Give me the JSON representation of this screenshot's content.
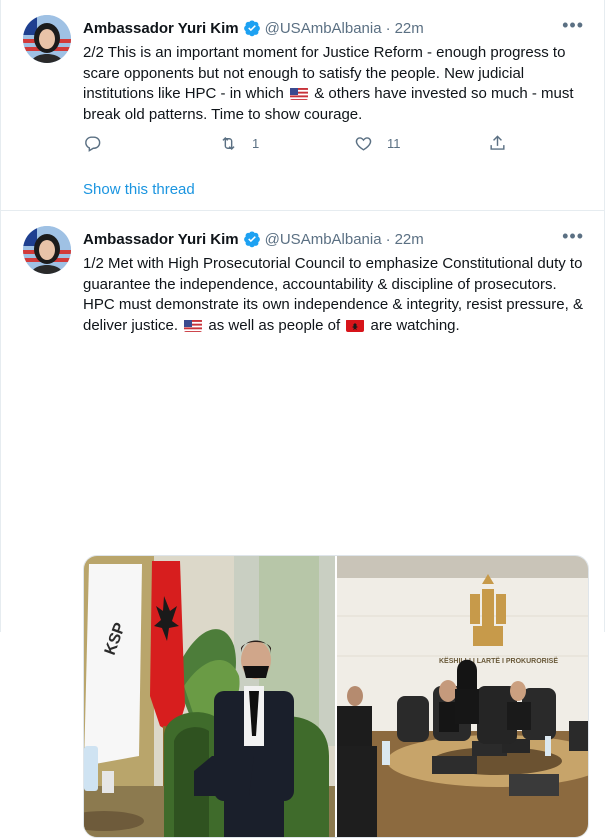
{
  "colors": {
    "link": "#1b95e0",
    "muted": "#5b7083",
    "verified": "#1da1f2",
    "divider": "#e6ecf0"
  },
  "tweets": [
    {
      "author": "Ambassador Yuri Kim",
      "handle": "@USAmbAlbania",
      "time": "22m",
      "verified_icon": "verified-badge-icon",
      "text_p1": "2/2 This is an important moment for Justice Reform - enough progress to scare opponents but not enough to satisfy the people. New judicial institutions like HPC - in which ",
      "text_p2": " & others have invested so much - must break old patterns. Time to show courage.",
      "flag_1": "us-flag-icon",
      "reply_icon": "reply-icon",
      "retweet_count": "1",
      "like_count": "11",
      "share_icon": "share-icon",
      "show_thread": "Show this thread"
    },
    {
      "author": "Ambassador Yuri Kim",
      "handle": "@USAmbAlbania",
      "time": "22m",
      "text_p1": "1/2 Met with High Prosecutorial Council to emphasize Constitutional duty to guarantee the independence, accountability & discipline of prosecutors. HPC must demonstrate its own independence & integrity, resist pressure, & deliver justice. ",
      "text_p2": " as well as people of ",
      "text_p3": " are watching.",
      "flag_1": "us-flag-icon",
      "flag_2": "albania-flag-icon",
      "photo_1_banner": "KSP",
      "photo_2_sign": "KËSHILLI I LARTË I PROKURORISË"
    }
  ]
}
